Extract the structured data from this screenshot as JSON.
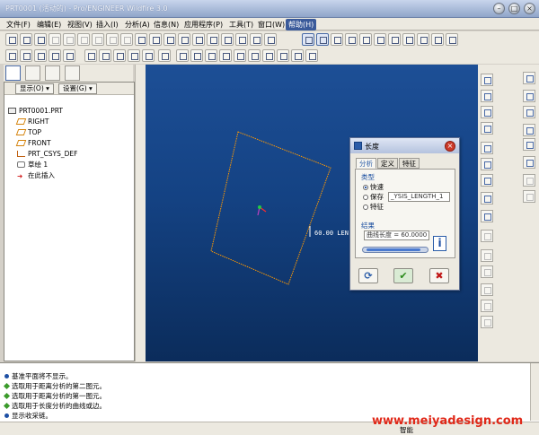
{
  "window": {
    "title": "PRT0001 (活动的) - Pro/ENGINEER Wildfire 3.0"
  },
  "menubar": {
    "items": [
      "文件(F)",
      "编辑(E)",
      "视图(V)",
      "插入(I)",
      "分析(A)",
      "信息(N)",
      "应用程序(P)",
      "工具(T)",
      "窗口(W)",
      "帮助(H)"
    ],
    "active_index": 9
  },
  "model_tree": {
    "show_label": "显示(O) ▾",
    "settings_label": "设置(G) ▾",
    "items": [
      "PRT0001.PRT",
      "RIGHT",
      "TOP",
      "FRONT",
      "PRT_CSYS_DEF",
      "草绘 1",
      "在此插入"
    ]
  },
  "viewport": {
    "dimension_label": "60.00 LEN",
    "colors": {
      "sketch": "#ff9900",
      "background_top": "#1d4f96",
      "background_bottom": "#0b2c5b"
    }
  },
  "measure_dialog": {
    "title": "长度",
    "tabs": [
      "分析",
      "定义",
      "特征"
    ],
    "type_group_label": "类型",
    "type_options": [
      "快速",
      "保存",
      "特征"
    ],
    "selected_type": "快速",
    "saved_name_value": "_YSIS_LENGTH_1",
    "result_group_label": "结果",
    "result_value": "曲线长度 = 60.0000",
    "info_icon": "i"
  },
  "messages": [
    "基准平面将不显示。",
    "选取用于距离分析的第二图元。",
    "选取用于距离分析的第一图元。",
    "选取用于长度分析的曲线或边。",
    "显示收采链。"
  ],
  "statusbar": {
    "filter_label": "智能"
  },
  "watermark": "www.meiyadesign.com"
}
